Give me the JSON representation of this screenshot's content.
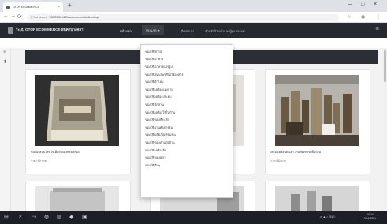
{
  "browser": {
    "tab_title": "OTOP ECOMMERCE",
    "new_tab_glyph": "+",
    "close_glyph": "×",
    "window_controls": [
      "–",
      "□",
      "×"
    ],
    "back_glyph": "←",
    "forward_glyph": "→",
    "reload_glyph": "⟳",
    "security_label": "ⓘ Not secure",
    "url": "202.29.51.182/ecommerce/otoplineshop/",
    "toolbar_icons": [
      "☆",
      "◉",
      "⋮"
    ]
  },
  "navbar": {
    "brand": "ระบบ OTOP ECOMMERCE สินค้าบางคล้า",
    "links": [
      "หน้าแรก",
      "ประเภทสินค้า",
      "ติดต่อเรา",
      "สำหรับร้านค้าและผู้ดูแลระบบ"
    ],
    "dropdown_label": "ประเภท",
    "dropdown_caret": "▾",
    "right_icon": "☰"
  },
  "gutter_icons": [
    "≡",
    "⬍"
  ],
  "section_title": "สินค้า",
  "dropdown_items": [
    "ของใช้ ทั่วไป",
    "ของใช้ อาหาร",
    "ของใช้ อาหารแปรรูป",
    "ของใช้ สมุนไพรที่ไม่ใช่อาหาร",
    "ของใช้ ผ้าไหม",
    "ของใช้ เครื่องแต่งกาย",
    "ของใช้ เครื่องประดับ",
    "ของใช้ จักสาน",
    "ของใช้ เครื่องใช้ในบ้าน",
    "ของใช้ ของที่ระลึก",
    "ของใช้ งานหัตถกรรม",
    "ของใช้ ผลิตภัณฑ์ชุมชน",
    "ของใช้ ของตกแต่งบ้าน",
    "ของใช้ เครื่องดื่ม",
    "ของใช้ ของฝาก",
    "ของใช้ อื่นๆ"
  ],
  "products": [
    {
      "title": "ขนมผิงสมุนไพร ไข่เค็มถั่วแดงทรงเครื่อง",
      "price": "ราคา 60 บาท"
    },
    {
      "title": "ของที่ระลึกจากบางคล้า",
      "price": "ราคา 120 บาท"
    },
    {
      "title": "เครื่องเคลือบดินเผา งานหัตถกรรมพื้นบ้าน",
      "price": "ราคา 80 บาท"
    }
  ],
  "taskbar": {
    "start_glyph": "⊞",
    "apps": [
      "⌕",
      "▭",
      "◍",
      "▤",
      "◆",
      "▣"
    ],
    "tray": "∧  ▲ ♪ ENG",
    "time": "10:24",
    "date": "2/11/2021"
  },
  "colors": {
    "navbar": "#26292f",
    "section_bar": "#2b2f35",
    "taskbar": "#1c1f26",
    "dropdown_bg": "#ffffff"
  }
}
